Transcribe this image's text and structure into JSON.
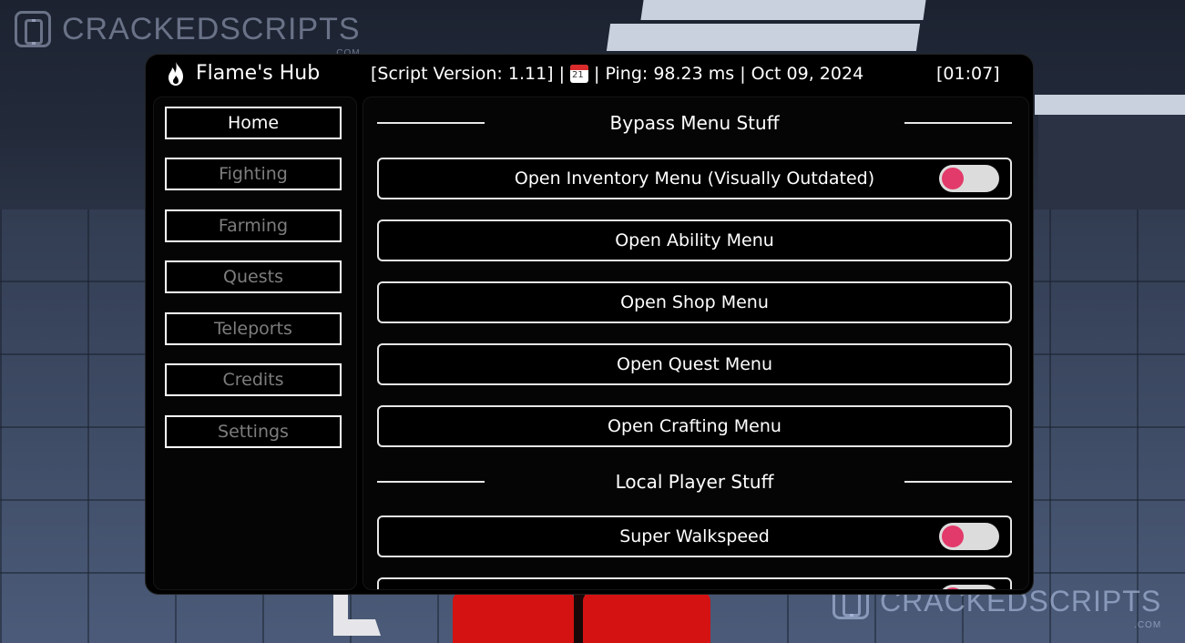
{
  "watermark": {
    "text": "CRACKEDSCRIPTS",
    "sub": ".COM"
  },
  "hub": {
    "title": "Flame's Hub",
    "info_prefix": "[Script Version: 1.11] |",
    "info_suffix": "| Ping: 98.23 ms | Oct 09, 2024",
    "clock": "[01:07]"
  },
  "sidebar": {
    "items": [
      {
        "label": "Home",
        "active": true
      },
      {
        "label": "Fighting",
        "active": false
      },
      {
        "label": "Farming",
        "active": false
      },
      {
        "label": "Quests",
        "active": false
      },
      {
        "label": "Teleports",
        "active": false
      },
      {
        "label": "Credits",
        "active": false
      },
      {
        "label": "Settings",
        "active": false
      }
    ]
  },
  "main": {
    "sections": [
      {
        "title": "Bypass Menu Stuff",
        "items": [
          {
            "label": "Open Inventory Menu (Visually Outdated)",
            "type": "toggle",
            "on": false
          },
          {
            "label": "Open Ability Menu",
            "type": "button"
          },
          {
            "label": "Open Shop Menu",
            "type": "button"
          },
          {
            "label": "Open Quest Menu",
            "type": "button"
          },
          {
            "label": "Open Crafting Menu",
            "type": "button"
          }
        ]
      },
      {
        "title": "Local Player Stuff",
        "items": [
          {
            "label": "Super Walkspeed",
            "type": "toggle",
            "on": false
          }
        ]
      }
    ]
  },
  "colors": {
    "toggle_knob": "#e23a6a",
    "toggle_track": "#dcdcdc",
    "inactive_text": "#7d7d7d",
    "panel_bg": "#000000"
  },
  "icons": {
    "title": "flame-icon",
    "info": "calendar-icon"
  }
}
